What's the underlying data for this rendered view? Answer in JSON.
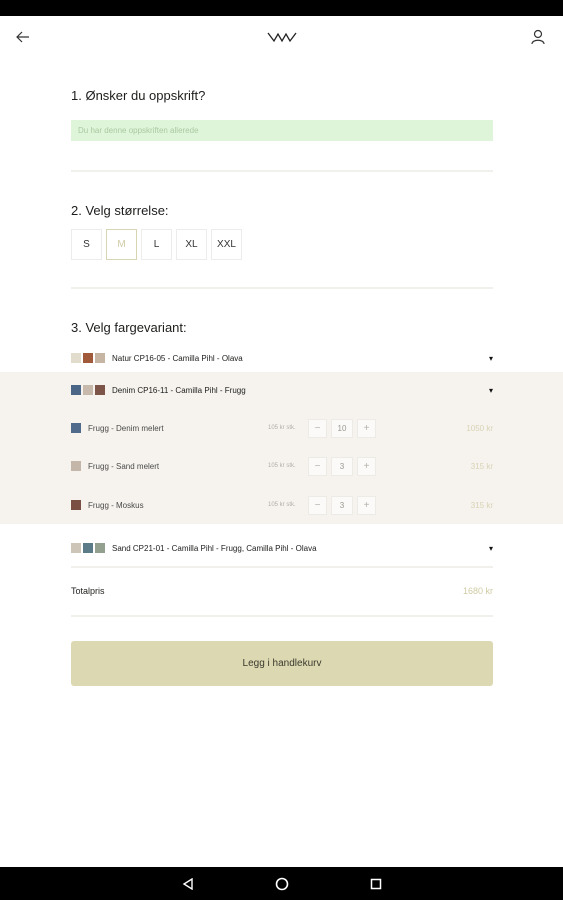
{
  "header": {
    "back_icon": "arrow-left-icon",
    "logo_icon": "brand-logo-icon",
    "profile_icon": "user-icon"
  },
  "section1": {
    "title": "1. Ønsker du oppskrift?",
    "recipe_notice": "Du har denne oppskriften allerede"
  },
  "section2": {
    "title": "2. Velg størrelse:",
    "sizes": [
      "S",
      "M",
      "L",
      "XL",
      "XXL"
    ],
    "selected": "M"
  },
  "section3": {
    "title": "3. Velg fargevariant:",
    "variants": [
      {
        "label": "Natur CP16-05 - Camilla Pihl - Olava",
        "swatches": [
          "#e2dccd",
          "#a05a3a",
          "#c5b5a2"
        ]
      },
      {
        "label": "Denim CP16-11 - Camilla Pihl - Frugg",
        "swatches": [
          "#4a6585",
          "#c8b9ad",
          "#7c5548"
        ]
      },
      {
        "label": "Sand CP21-01 - Camilla Pihl - Frugg, Camilla Pihl - Olava",
        "swatches": [
          "#cdc5b8",
          "#5a7b87",
          "#93a090"
        ]
      }
    ],
    "expanded_items": [
      {
        "label": "Frugg - Denim melert",
        "unit_price": "105 kr stk.",
        "qty": "10",
        "total": "1050 kr",
        "swatch": "#4f6a8a"
      },
      {
        "label": "Frugg - Sand melert",
        "unit_price": "105 kr stk.",
        "qty": "3",
        "total": "315 kr",
        "swatch": "#c4b6a9"
      },
      {
        "label": "Frugg - Moskus",
        "unit_price": "105 kr stk.",
        "qty": "3",
        "total": "315 kr",
        "swatch": "#7a4e42"
      }
    ],
    "minus": "−",
    "plus": "+"
  },
  "total": {
    "label": "Totalpris",
    "value": "1680 kr"
  },
  "cart_button": "Legg i handlekurv",
  "nav": {
    "back_icon": "triangle-back-icon",
    "home_icon": "circle-home-icon",
    "recents_icon": "square-recents-icon"
  }
}
